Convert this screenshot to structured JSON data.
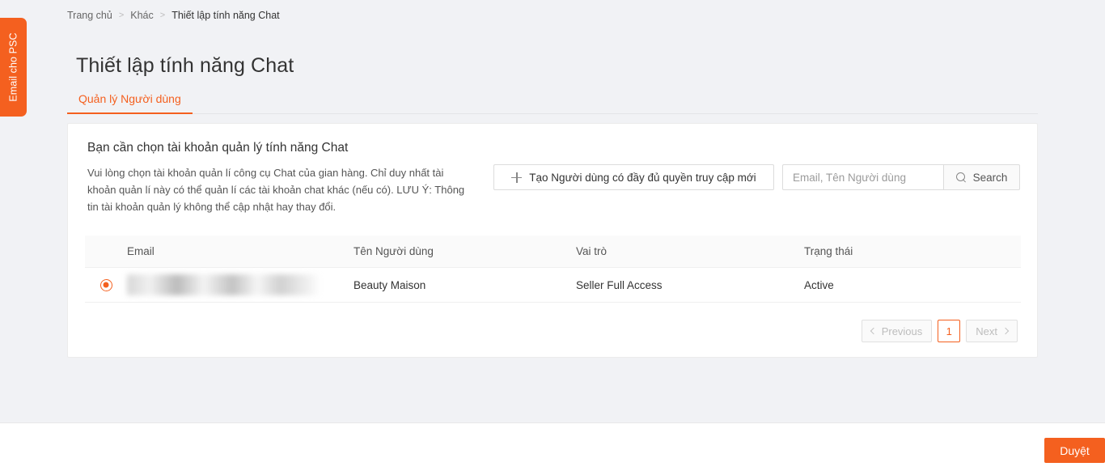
{
  "side_tab": {
    "label": "Email cho PSC"
  },
  "breadcrumb": {
    "items": [
      {
        "label": "Trang chủ"
      },
      {
        "label": "Khác"
      },
      {
        "label": "Thiết lập tính năng Chat"
      }
    ],
    "separator": ">"
  },
  "page_title": "Thiết lập tính năng Chat",
  "tabs": [
    {
      "label": "Quản lý Người dùng",
      "active": true
    }
  ],
  "card": {
    "heading": "Bạn cần chọn tài khoản quản lý tính năng Chat",
    "description": "Vui lòng chọn tài khoản quản lí công cụ Chat của gian hàng. Chỉ duy nhất tài khoản quản lí này có thể quản lí các tài khoản chat khác (nếu có). LƯU Ý: Thông tin tài khoản quản lý không thể cập nhật hay thay đổi.",
    "create_button": "Tạo Người dùng có đầy đủ quyền truy cập mới",
    "create_icon": "plus-icon",
    "search": {
      "placeholder": "Email, Tên Người dùng",
      "value": "",
      "button_label": "Search",
      "button_icon": "search-icon"
    }
  },
  "table": {
    "columns": [
      "Email",
      "Tên Người dùng",
      "Vai trò",
      "Trạng thái"
    ],
    "rows": [
      {
        "selected": true,
        "email": "",
        "email_redacted": true,
        "name": "Beauty Maison",
        "role": "Seller Full Access",
        "status": "Active"
      }
    ]
  },
  "pagination": {
    "previous": "Previous",
    "next": "Next",
    "pages": [
      "1"
    ],
    "current_page": "1"
  },
  "footer": {
    "submit_label": "Duyệt"
  },
  "colors": {
    "accent": "#f4601f",
    "page_background": "#f1f2f5",
    "card_background": "#ffffff",
    "text": "#333333",
    "muted_text": "#9b9b9b",
    "border": "#e3e5e8"
  }
}
